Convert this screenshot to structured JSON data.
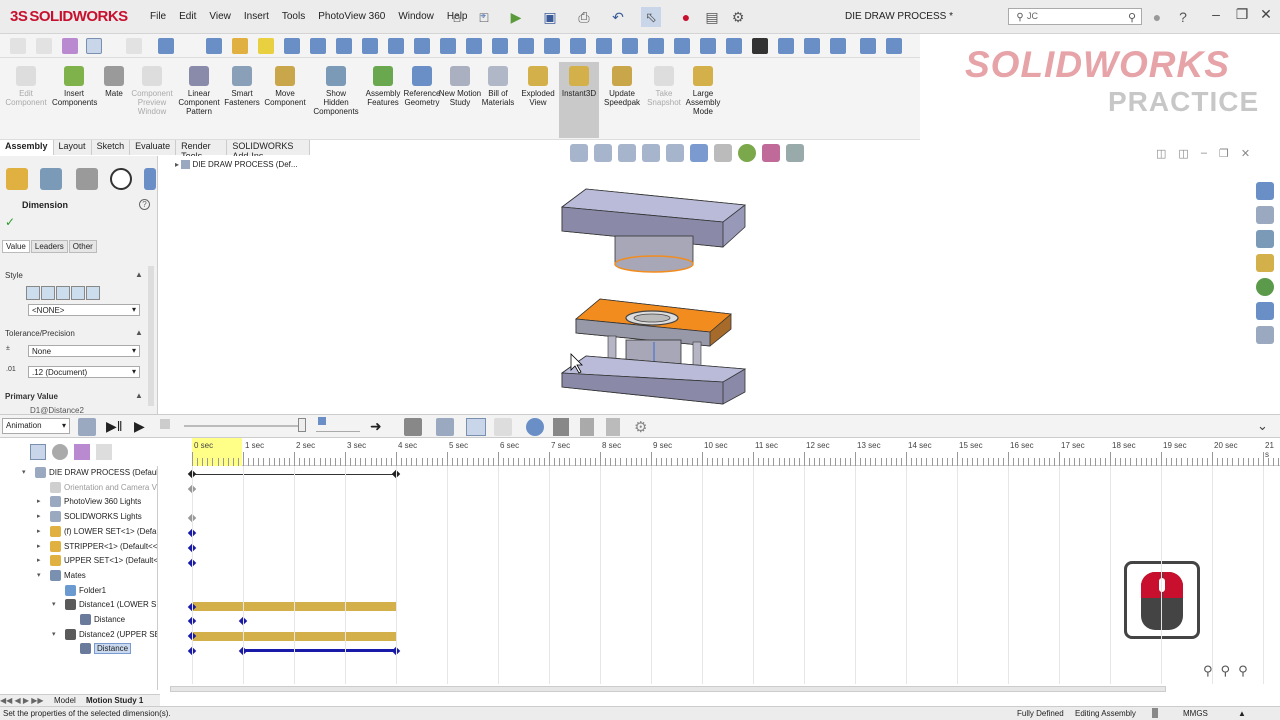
{
  "app": {
    "brand": "SOLIDWORKS",
    "title": "DIE DRAW PROCESS *",
    "menu": [
      "File",
      "Edit",
      "View",
      "Insert",
      "Tools",
      "PhotoView 360",
      "Window",
      "Help"
    ],
    "search_value": "JC",
    "watermark_line1": "SOLIDWORKS",
    "watermark_line2": "PRACTICE"
  },
  "command_manager": [
    {
      "label": "Edit Component",
      "enabled": false,
      "color": "#cfcfcf"
    },
    {
      "label": "Insert Components",
      "enabled": true,
      "color": "#7fb24a"
    },
    {
      "label": "Mate",
      "enabled": true,
      "color": "#9a9a9a"
    },
    {
      "label": "Component Preview Window",
      "enabled": false,
      "color": "#cfcfcf"
    },
    {
      "label": "Linear Component Pattern",
      "enabled": true,
      "color": "#8a8aaa"
    },
    {
      "label": "Smart Fasteners",
      "enabled": true,
      "color": "#8aa0b8"
    },
    {
      "label": "Move Component",
      "enabled": true,
      "color": "#c9a64a"
    },
    {
      "label": "Show Hidden Components",
      "enabled": true,
      "color": "#7a9ab8"
    },
    {
      "label": "Assembly Features",
      "enabled": true,
      "color": "#6aa84f"
    },
    {
      "label": "Reference Geometry",
      "enabled": true,
      "color": "#6a8fc7"
    },
    {
      "label": "New Motion Study",
      "enabled": true,
      "color": "#aab0c0"
    },
    {
      "label": "Bill of Materials",
      "enabled": true,
      "color": "#b0b8c8"
    },
    {
      "label": "Exploded View",
      "enabled": true,
      "color": "#d4b04a"
    },
    {
      "label": "Instant3D",
      "enabled": true,
      "color": "#d4b04a"
    },
    {
      "label": "Update Speedpak",
      "enabled": true,
      "color": "#c9a64a"
    },
    {
      "label": "Take Snapshot",
      "enabled": false,
      "color": "#cfcfcf"
    },
    {
      "label": "Large Assembly Mode",
      "enabled": true,
      "color": "#d4b04a"
    }
  ],
  "tabs": [
    "Assembly",
    "Layout",
    "Sketch",
    "Evaluate",
    "Render Tools",
    "SOLIDWORKS Add-Ins"
  ],
  "property_manager": {
    "title": "Dimension",
    "help": "?",
    "tabs": [
      "Value",
      "Leaders",
      "Other"
    ],
    "style_label": "Style",
    "style_value": "<NONE>",
    "tolerance_label": "Tolerance/Precision",
    "tolerance_value": "None",
    "precision_value": ".12 (Document)",
    "primary_value_label": "Primary Value",
    "primary_value_partial": "D1@Distance2"
  },
  "feature_tree_root": "DIE DRAW PROCESS  (Def...",
  "motion": {
    "study_type": "Animation",
    "time_labels": [
      "0 sec",
      "1 sec",
      "2 sec",
      "3 sec",
      "4 sec",
      "5 sec",
      "6 sec",
      "7 sec",
      "8 sec",
      "9 sec",
      "10 sec",
      "11 sec",
      "12 sec",
      "13 sec",
      "14 sec",
      "15 sec",
      "16 sec",
      "17 sec",
      "18 sec",
      "19 sec",
      "20 sec",
      "21 s"
    ],
    "tree": [
      {
        "label": "DIE DRAW PROCESS  (Default<Dis",
        "level": 0,
        "expander": "▾",
        "icon": "#9aa8c0"
      },
      {
        "label": "Orientation and Camera Views",
        "level": 1,
        "expander": "",
        "icon": "#cfcfcf",
        "dim": true
      },
      {
        "label": "PhotoView 360 Lights",
        "level": 1,
        "expander": "▸",
        "icon": "#9aa8c0"
      },
      {
        "label": "SOLIDWORKS Lights",
        "level": 1,
        "expander": "▸",
        "icon": "#9aa8c0"
      },
      {
        "label": "(f) LOWER SET<1> (Default<<",
        "level": 1,
        "expander": "▸",
        "icon": "#e0b040"
      },
      {
        "label": "STRIPPER<1> (Default<<Defa",
        "level": 1,
        "expander": "▸",
        "icon": "#e0b040"
      },
      {
        "label": "UPPER SET<1> (Default<<Def",
        "level": 1,
        "expander": "▸",
        "icon": "#e0b040"
      },
      {
        "label": "Mates",
        "level": 1,
        "expander": "▾",
        "icon": "#7a90b0"
      },
      {
        "label": "Folder1",
        "level": 2,
        "expander": "",
        "icon": "#6a9ad0"
      },
      {
        "label": "Distance1 (LOWER SET<1",
        "level": 2,
        "expander": "▾",
        "icon": "#5a5a5a"
      },
      {
        "label": "Distance",
        "level": 3,
        "expander": "",
        "icon": "#6a7a9a"
      },
      {
        "label": "Distance2 (UPPER SET<1>",
        "level": 2,
        "expander": "▾",
        "icon": "#5a5a5a"
      },
      {
        "label": "Distance",
        "level": 3,
        "expander": "",
        "icon": "#6a7a9a",
        "selected": true
      }
    ],
    "tracks": [
      {
        "row": 0,
        "keys": [
          0,
          4
        ],
        "line_to": 4
      },
      {
        "row": 1,
        "keys": [
          0
        ],
        "gray": true
      },
      {
        "row": 3,
        "keys": [
          0
        ],
        "gray": true
      },
      {
        "row": 4,
        "keys": [
          0
        ]
      },
      {
        "row": 5,
        "keys": [
          0
        ]
      },
      {
        "row": 6,
        "keys": [
          0
        ]
      },
      {
        "row": 9,
        "keys": [
          0
        ],
        "bar": [
          0,
          4
        ]
      },
      {
        "row": 10,
        "keys": [
          0,
          1
        ]
      },
      {
        "row": 11,
        "keys": [
          0
        ],
        "bar": [
          0,
          4
        ]
      },
      {
        "row": 12,
        "keys": [
          0,
          1,
          4
        ],
        "blue_line": [
          1,
          4
        ]
      }
    ],
    "bottom_tabs": [
      "Model",
      "Motion Study 1"
    ]
  },
  "status": {
    "message": "Set the properties of the selected dimension(s).",
    "definition": "Fully Defined",
    "mode": "Editing Assembly",
    "units": "MMGS"
  },
  "colors": {
    "accent": "#c8102e",
    "keyframe": "#1a1aa8",
    "bar": "#d4b04a",
    "plate_top": "#b9bbd8",
    "stripper": "#f28c1e"
  }
}
